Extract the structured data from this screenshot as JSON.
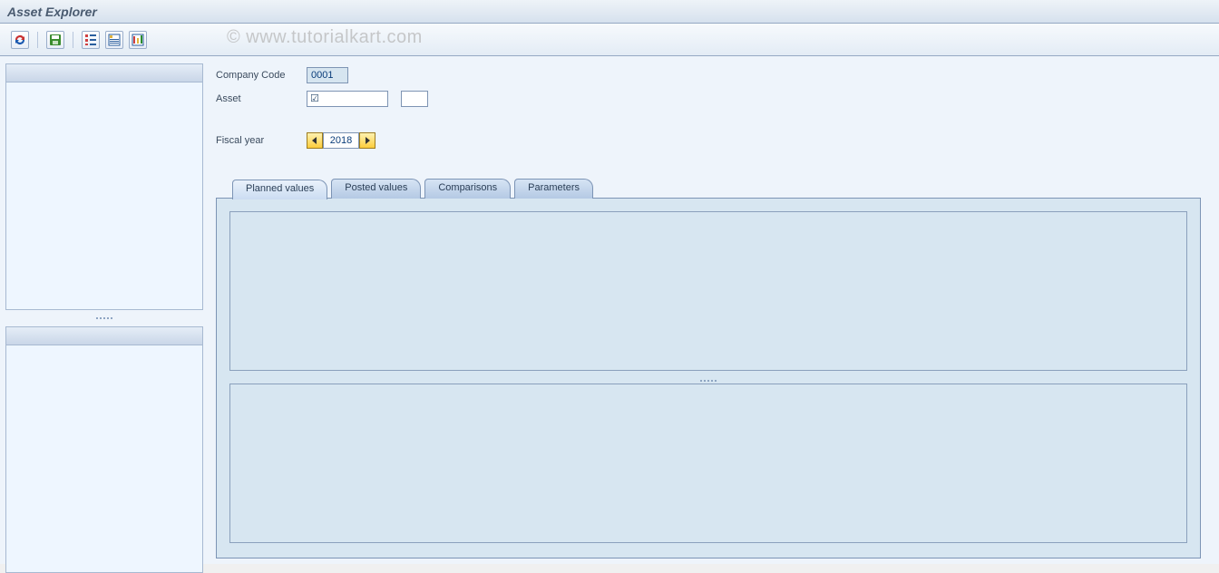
{
  "header": {
    "title": "Asset Explorer"
  },
  "watermark": "© www.tutorialkart.com",
  "toolbar_icons": {
    "refresh": "refresh-icon",
    "save": "save-icon",
    "schema": "schema-icon",
    "plan": "plan-icon",
    "posted": "posted-icon"
  },
  "fields": {
    "company_code_label": "Company Code",
    "company_code_value": "0001",
    "asset_label": "Asset",
    "asset_value": "",
    "asset_sub_value": "",
    "fiscal_year_label": "Fiscal year",
    "fiscal_year_value": "2018"
  },
  "tabs": [
    {
      "id": "planned",
      "label": "Planned values"
    },
    {
      "id": "posted",
      "label": "Posted values"
    },
    {
      "id": "comparisons",
      "label": "Comparisons"
    },
    {
      "id": "parameters",
      "label": "Parameters"
    }
  ],
  "asset_checkbox_checked": true
}
